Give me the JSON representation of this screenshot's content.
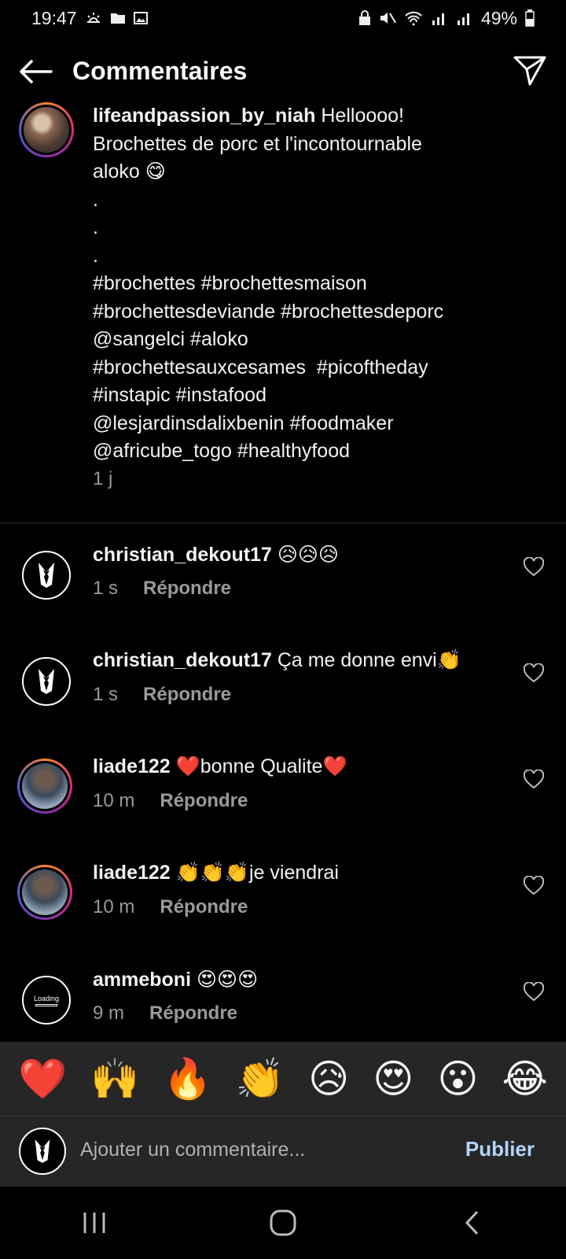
{
  "status_bar": {
    "time": "19:47",
    "battery": "49%"
  },
  "header": {
    "title": "Commentaires"
  },
  "caption": {
    "username": "lifeandpassion_by_niah",
    "lines": [
      "Helloooo!",
      "Brochettes de porc et l'incontournable",
      "aloko 😋",
      ".",
      ".",
      ".",
      "#brochettes #brochettesmaison",
      "#brochettesdeviande #brochettesdeporc",
      "@sangelci #aloko",
      "#brochettesauxcesames  #picoftheday",
      "#instapic #instafood",
      "@lesjardinsdalixbenin #foodmaker",
      "@africube_togo #healthyfood"
    ],
    "time": "1 j"
  },
  "comments": [
    {
      "username": "christian_dekout17",
      "text": "😥😥😥",
      "time": "1 s",
      "reply": "Répondre"
    },
    {
      "username": "christian_dekout17",
      "text": "Ça me donne envi👏",
      "time": "1 s",
      "reply": "Répondre"
    },
    {
      "username": "liade122",
      "text": "❤️bonne Qualite❤️",
      "time": "10 m",
      "reply": "Répondre"
    },
    {
      "username": "liade122",
      "text": "👏👏👏je viendrai",
      "time": "10 m",
      "reply": "Répondre"
    },
    {
      "username": "ammeboni",
      "text": "😍😍😍",
      "time": "9 m",
      "reply": "Répondre",
      "avatar_text": "Loading"
    }
  ],
  "emoji_bar": [
    "❤️",
    "🙌",
    "🔥",
    "👏",
    "😥",
    "😍",
    "😮",
    "😂"
  ],
  "input": {
    "placeholder": "Ajouter un commentaire...",
    "publish": "Publier"
  },
  "colors": {
    "background": "#000000",
    "panel": "#262626",
    "muted": "#9a9a9a",
    "publish": "#b3d4fb"
  }
}
